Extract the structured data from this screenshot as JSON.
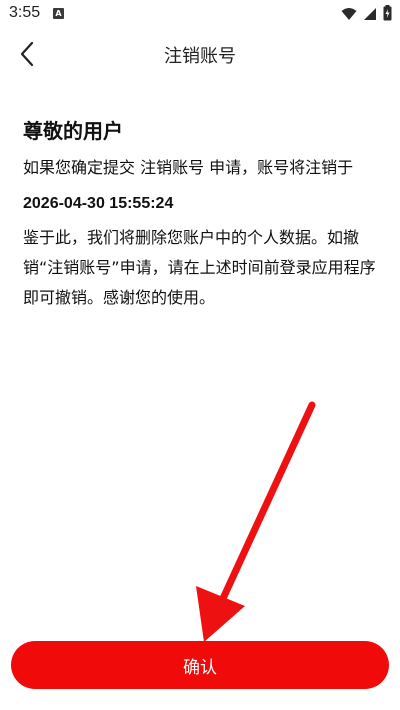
{
  "status_bar": {
    "time": "3:55",
    "notification_icon": "a-icon",
    "icons": [
      "wifi-icon",
      "signal-icon",
      "battery-icon"
    ]
  },
  "header": {
    "title": "注销账号",
    "back_icon": "chevron-left-icon"
  },
  "content": {
    "greeting": "尊敬的用户",
    "paragraph1": "如果您确定提交 注销账号 申请，账号将注销于",
    "datetime": "2026-04-30 15:55:24",
    "paragraph2": "鉴于此，我们将删除您账户中的个人数据。如撤销“注销账号”申请，请在上述时间前登录应用程序即可撤销。感谢您的使用。"
  },
  "confirm_button": {
    "label": "确认"
  },
  "colors": {
    "accent": "#f00a0a",
    "annotation_arrow": "#ee1111"
  }
}
